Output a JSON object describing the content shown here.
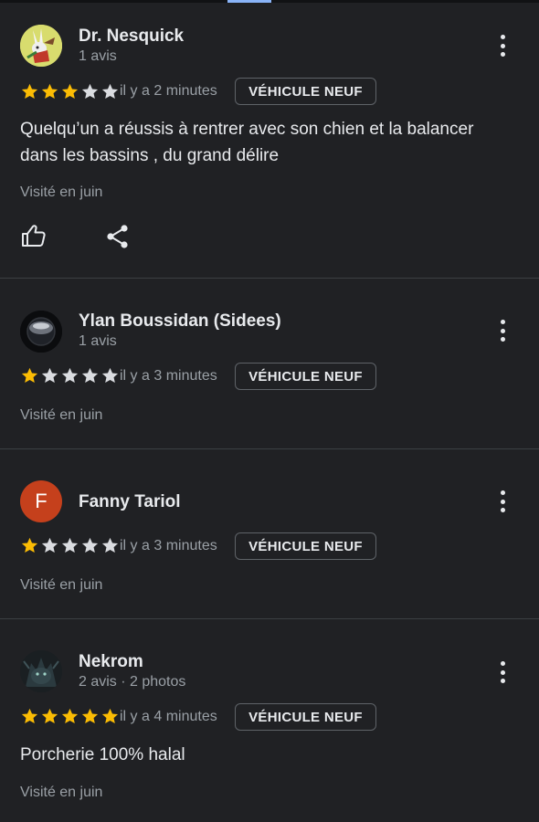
{
  "reviews": [
    {
      "name": "Dr. Nesquick",
      "meta": "1 avis",
      "rating": 3,
      "time": "il y a 2 minutes",
      "tag": "VÉHICULE NEUF",
      "text": "Quelqu’un a réussis à rentrer avec son chien et la balancer dans les bassins , du grand délire",
      "visited": "Visité en juin"
    },
    {
      "name": "Ylan Boussidan (Sidees)",
      "meta": "1 avis",
      "rating": 1,
      "time": "il y a 3 minutes",
      "tag": "VÉHICULE NEUF",
      "visited": "Visité en juin"
    },
    {
      "name": "Fanny Tariol",
      "avatar_letter": "F",
      "avatar_color": "#c5401c",
      "rating": 1,
      "time": "il y a 3 minutes",
      "tag": "VÉHICULE NEUF",
      "visited": "Visité en juin"
    },
    {
      "name": "Nekrom",
      "meta": "2 avis · 2 photos",
      "rating": 5,
      "time": "il y a 4 minutes",
      "tag": "VÉHICULE NEUF",
      "text": "Porcherie 100% halal",
      "visited": "Visité en juin"
    }
  ],
  "max_rating": 5,
  "colors": {
    "background": "#202124",
    "star_filled": "#fbbc04",
    "star_empty": "#dadce0",
    "divider": "#3c4043"
  },
  "icons": [
    "thumbs-up-icon",
    "share-icon",
    "more-vert-icon",
    "star-icon"
  ]
}
